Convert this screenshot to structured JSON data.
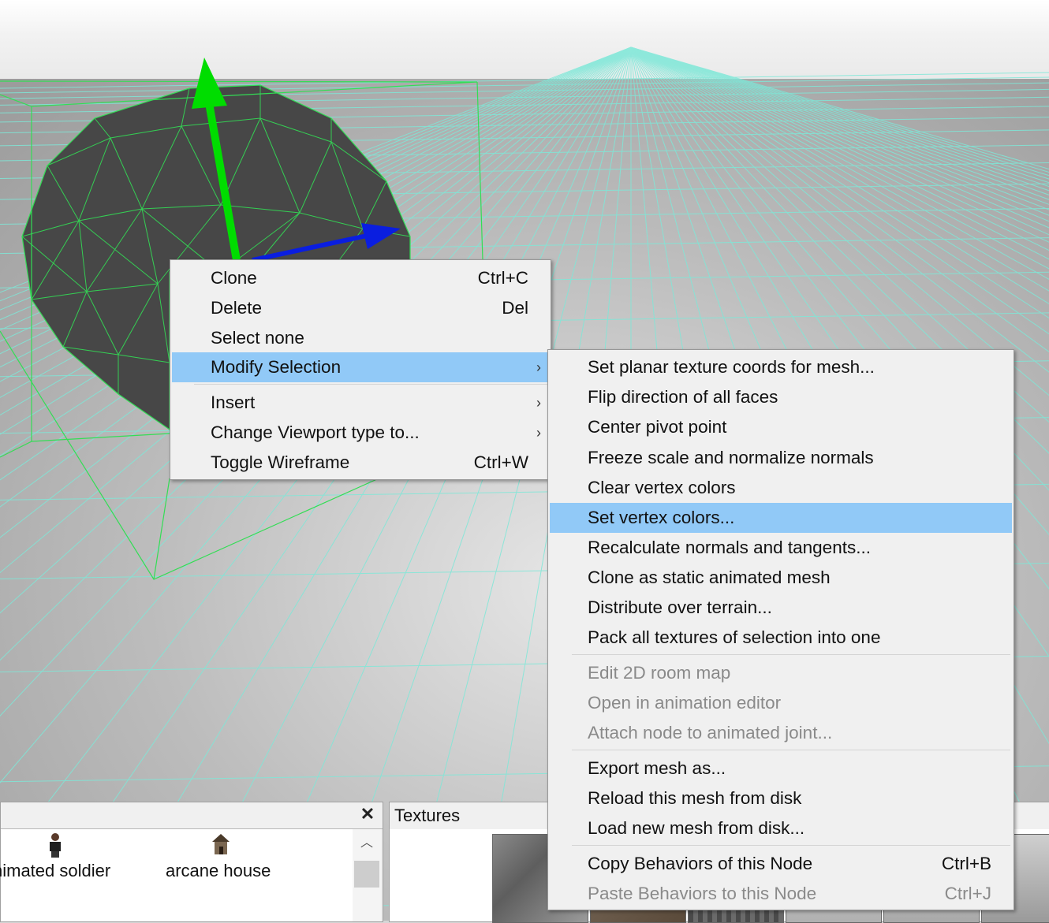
{
  "main_menu": {
    "items": [
      {
        "label": "Clone",
        "shortcut": "Ctrl+C"
      },
      {
        "label": "Delete",
        "shortcut": "Del"
      },
      {
        "label": "Select none",
        "shortcut": ""
      },
      {
        "label": "Modify Selection",
        "submenu": true,
        "highlighted": true
      },
      {
        "label": "Insert",
        "submenu": true
      },
      {
        "label": "Change Viewport type to...",
        "submenu": true
      },
      {
        "label": "Toggle Wireframe",
        "shortcut": "Ctrl+W"
      }
    ]
  },
  "sub_menu": {
    "items": [
      {
        "label": "Set planar texture coords for mesh..."
      },
      {
        "label": "Flip direction of all faces"
      },
      {
        "label": "Center pivot point"
      },
      {
        "label": "Freeze scale and normalize normals"
      },
      {
        "label": "Clear vertex colors"
      },
      {
        "label": "Set vertex colors...",
        "highlighted": true
      },
      {
        "label": "Recalculate normals and tangents..."
      },
      {
        "label": "Clone as static animated mesh"
      },
      {
        "label": "Distribute over terrain..."
      },
      {
        "label": "Pack all textures of selection into one"
      },
      {
        "label": "Edit 2D room map",
        "disabled": true
      },
      {
        "label": "Open in animation editor",
        "disabled": true
      },
      {
        "label": "Attach node to animated joint...",
        "disabled": true
      },
      {
        "label": "Export mesh as..."
      },
      {
        "label": "Reload this mesh from disk"
      },
      {
        "label": "Load new mesh from disk..."
      },
      {
        "label": "Copy Behaviors of this Node",
        "shortcut": "Ctrl+B"
      },
      {
        "label": "Paste Behaviors to this Node",
        "shortcut": "Ctrl+J",
        "disabled": true
      }
    ]
  },
  "objects_panel": {
    "close_icon": "close-icon",
    "items": [
      {
        "label": "nimated soldier",
        "icon": "soldier-thumbnail"
      },
      {
        "label": "arcane house",
        "icon": "house-thumbnail"
      }
    ]
  },
  "textures_panel": {
    "title": "Textures"
  },
  "colors": {
    "highlight": "#91c9f7",
    "menu_bg": "#f0f0f0",
    "disabled_text": "#8a8a8a",
    "gizmo_y": "#00dd00",
    "gizmo_x": "#0a1ee0",
    "wireframe": "#33dd55",
    "grid": "#7ee8d8",
    "mesh": "#484848"
  }
}
